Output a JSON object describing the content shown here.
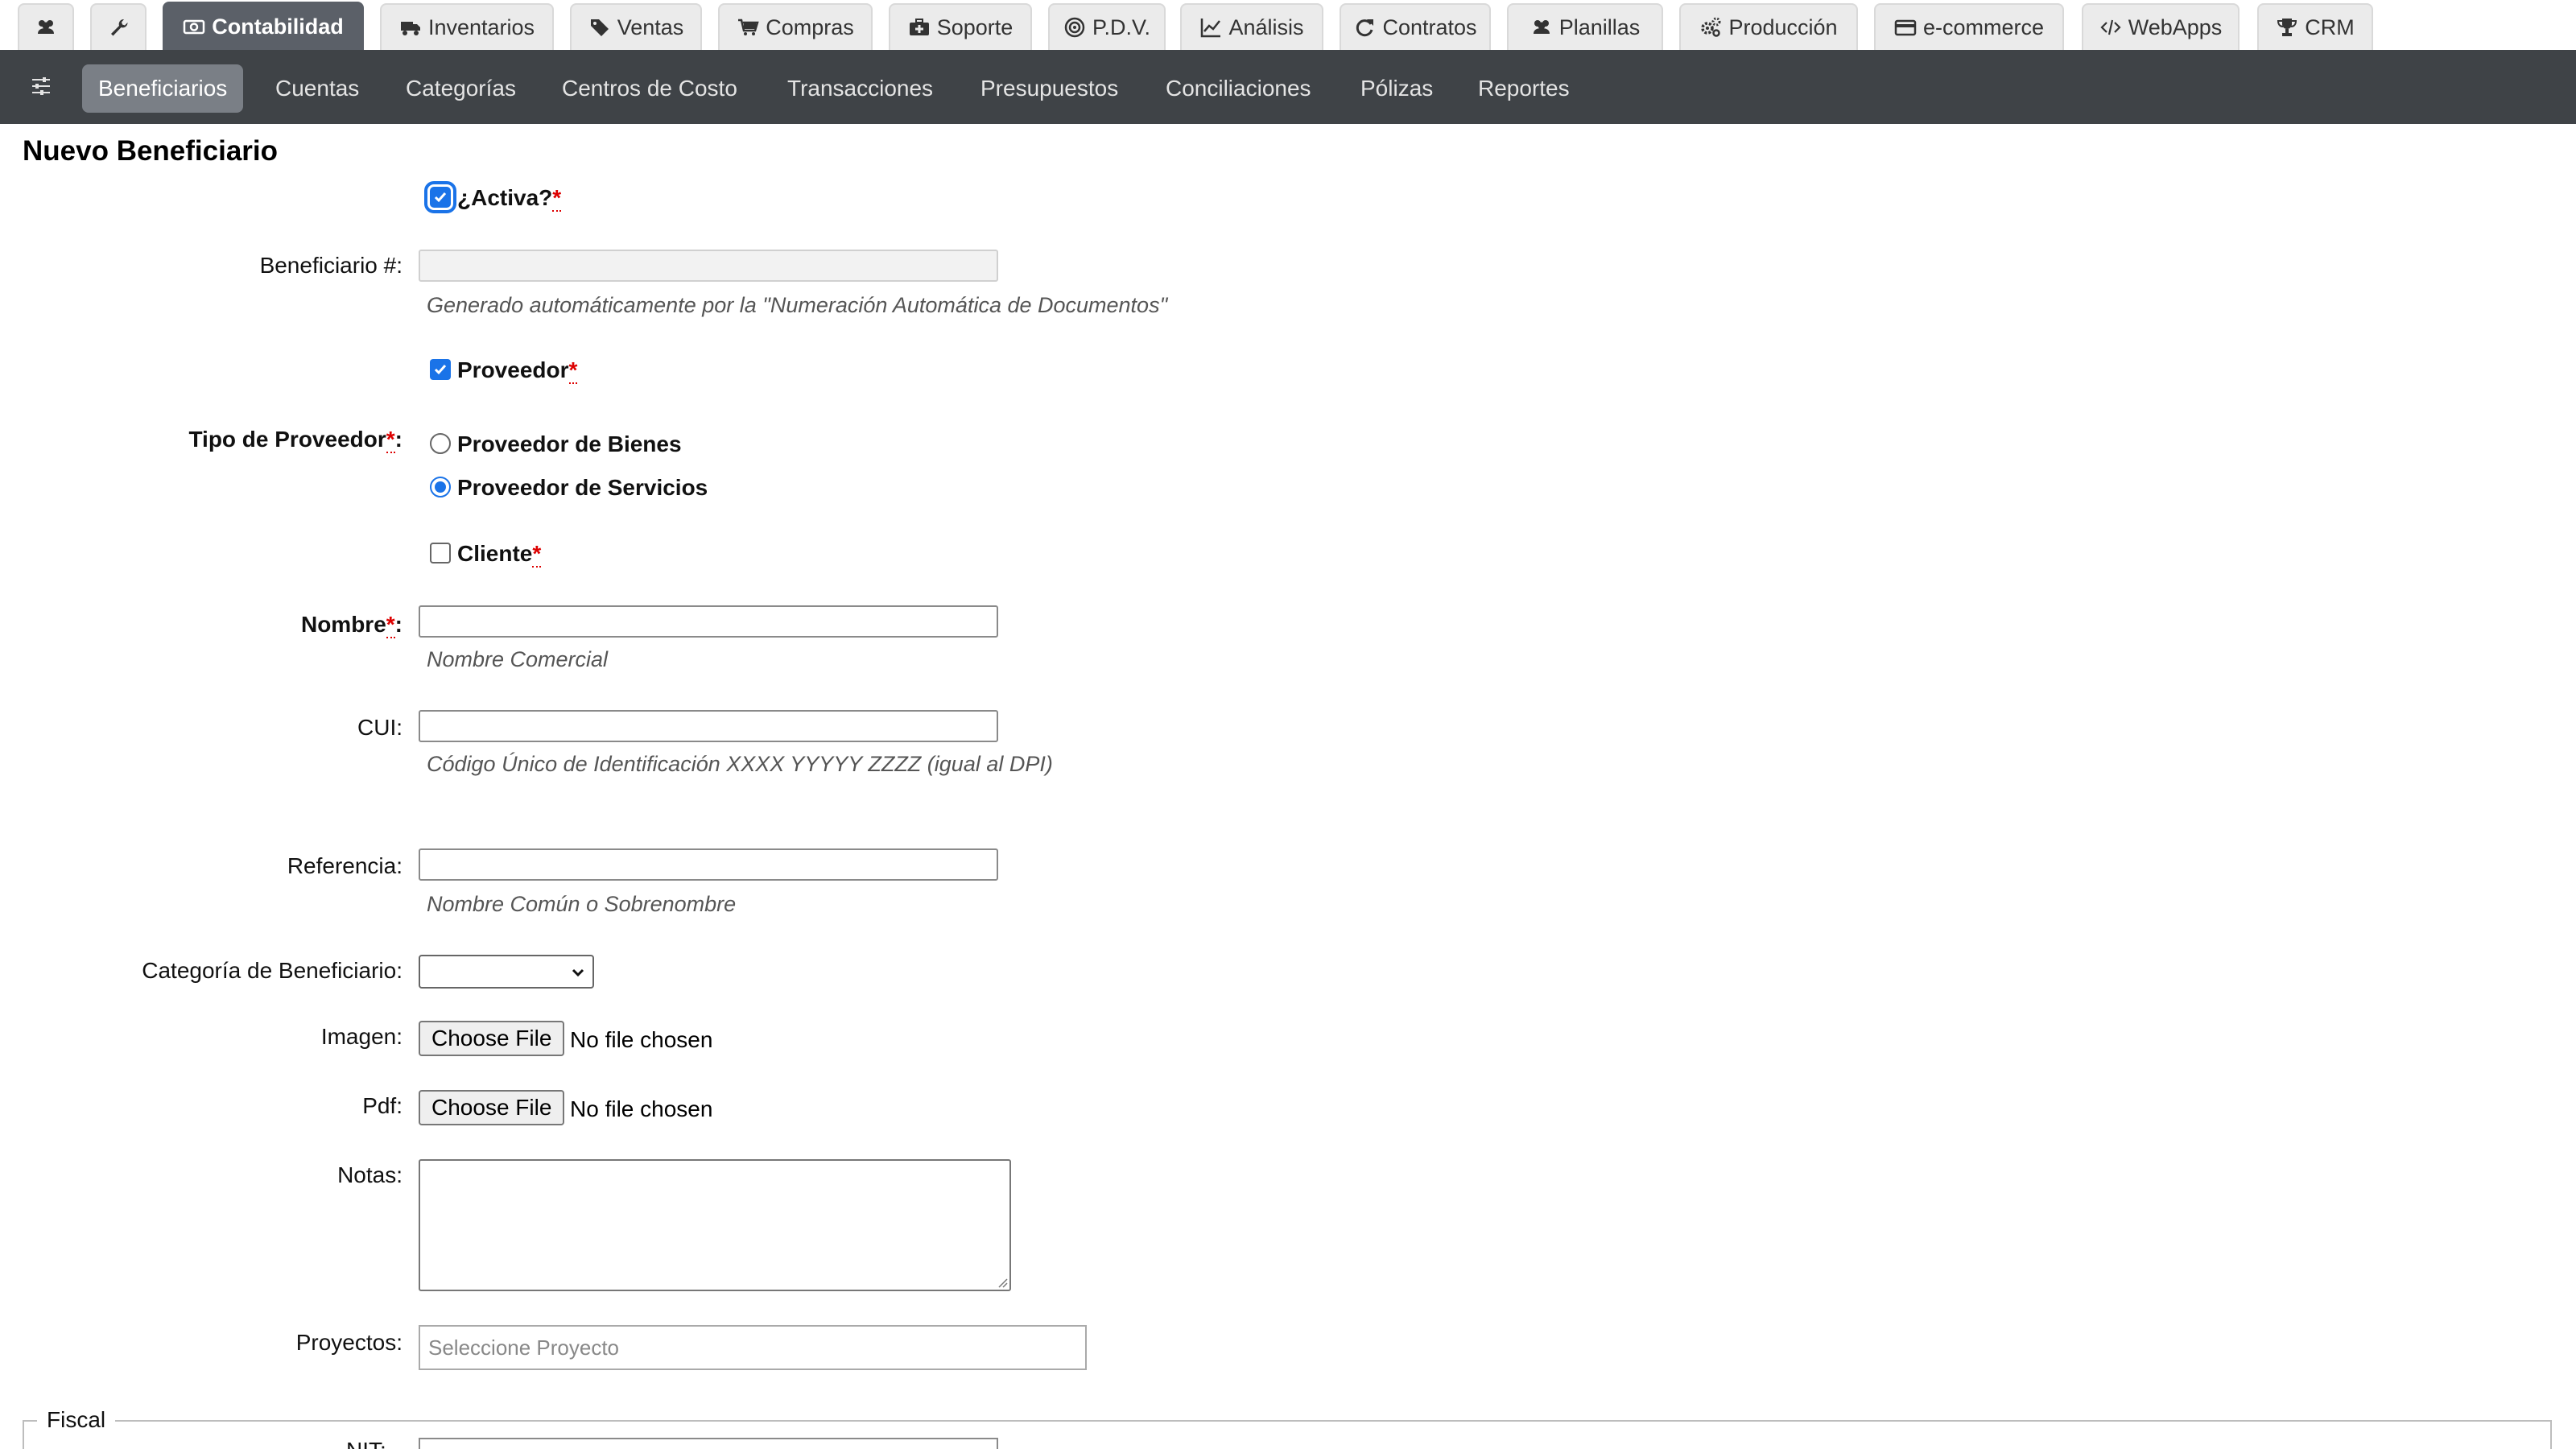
{
  "top_tabs": [
    {
      "key": "users",
      "label": "",
      "icon": "users-icon"
    },
    {
      "key": "tools",
      "label": "",
      "icon": "wrench-icon"
    },
    {
      "key": "contabilidad",
      "label": "Contabilidad",
      "icon": "money-icon"
    },
    {
      "key": "inventarios",
      "label": "Inventarios",
      "icon": "truck-icon"
    },
    {
      "key": "ventas",
      "label": "Ventas",
      "icon": "tags-icon"
    },
    {
      "key": "compras",
      "label": "Compras",
      "icon": "cart-icon"
    },
    {
      "key": "soporte",
      "label": "Soporte",
      "icon": "medkit-icon"
    },
    {
      "key": "pdv",
      "label": "P.D.V.",
      "icon": "target-icon"
    },
    {
      "key": "analisis",
      "label": "Análisis",
      "icon": "line-chart-icon"
    },
    {
      "key": "contratos",
      "label": "Contratos",
      "icon": "refresh-icon"
    },
    {
      "key": "planillas",
      "label": "Planillas",
      "icon": "users-icon"
    },
    {
      "key": "produccion",
      "label": "Producción",
      "icon": "gears-icon"
    },
    {
      "key": "ecommerce",
      "label": "e-commerce",
      "icon": "credit-card-icon"
    },
    {
      "key": "webapps",
      "label": "WebApps",
      "icon": "code-icon"
    },
    {
      "key": "crm",
      "label": "CRM",
      "icon": "trophy-icon"
    }
  ],
  "active_top_tab": "contabilidad",
  "subnav": {
    "items": [
      "Beneficiarios",
      "Cuentas",
      "Categorías",
      "Centros de Costo",
      "Transacciones",
      "Presupuestos",
      "Conciliaciones",
      "Pólizas",
      "Reportes"
    ],
    "active": "Beneficiarios"
  },
  "form": {
    "title": "Nuevo Beneficiario",
    "activa": {
      "label": "¿Activa?",
      "required_mark": "*",
      "checked": true
    },
    "beneficiario_num": {
      "label": "Beneficiario #:",
      "value": "",
      "hint": "Generado automáticamente por la \"Numeración Automática de Documentos\""
    },
    "proveedor": {
      "label": "Proveedor",
      "required_mark": "*",
      "checked": true
    },
    "tipo_proveedor": {
      "label": "Tipo de Proveedor",
      "required_mark": "*",
      "suffix": ":",
      "options": [
        {
          "label": "Proveedor de Bienes",
          "selected": false
        },
        {
          "label": "Proveedor de Servicios",
          "selected": true
        }
      ]
    },
    "cliente": {
      "label": "Cliente",
      "required_mark": "*",
      "checked": false
    },
    "nombre": {
      "label": "Nombre",
      "required_mark": "*",
      "suffix": ":",
      "value": "",
      "hint": "Nombre Comercial"
    },
    "cui": {
      "label": "CUI:",
      "value": "",
      "hint": "Código Único de Identificación XXXX YYYYY ZZZZ (igual al DPI)"
    },
    "referencia": {
      "label": "Referencia:",
      "value": "",
      "hint": "Nombre Común o Sobrenombre"
    },
    "categoria": {
      "label": "Categoría de Beneficiario:",
      "value": ""
    },
    "imagen": {
      "label": "Imagen:",
      "button": "Choose File",
      "status": "No file chosen"
    },
    "pdf": {
      "label": "Pdf:",
      "button": "Choose File",
      "status": "No file chosen"
    },
    "notas": {
      "label": "Notas:",
      "value": ""
    },
    "proyectos": {
      "label": "Proyectos:",
      "placeholder": "Seleccione Proyecto"
    },
    "fiscal": {
      "legend": "Fiscal",
      "nit_label": "NIT:"
    }
  },
  "colors": {
    "accent": "#1a73e8",
    "required": "#dd0000",
    "subnav_bg": "#3f4347",
    "active_tab_bg": "#5b6068"
  }
}
